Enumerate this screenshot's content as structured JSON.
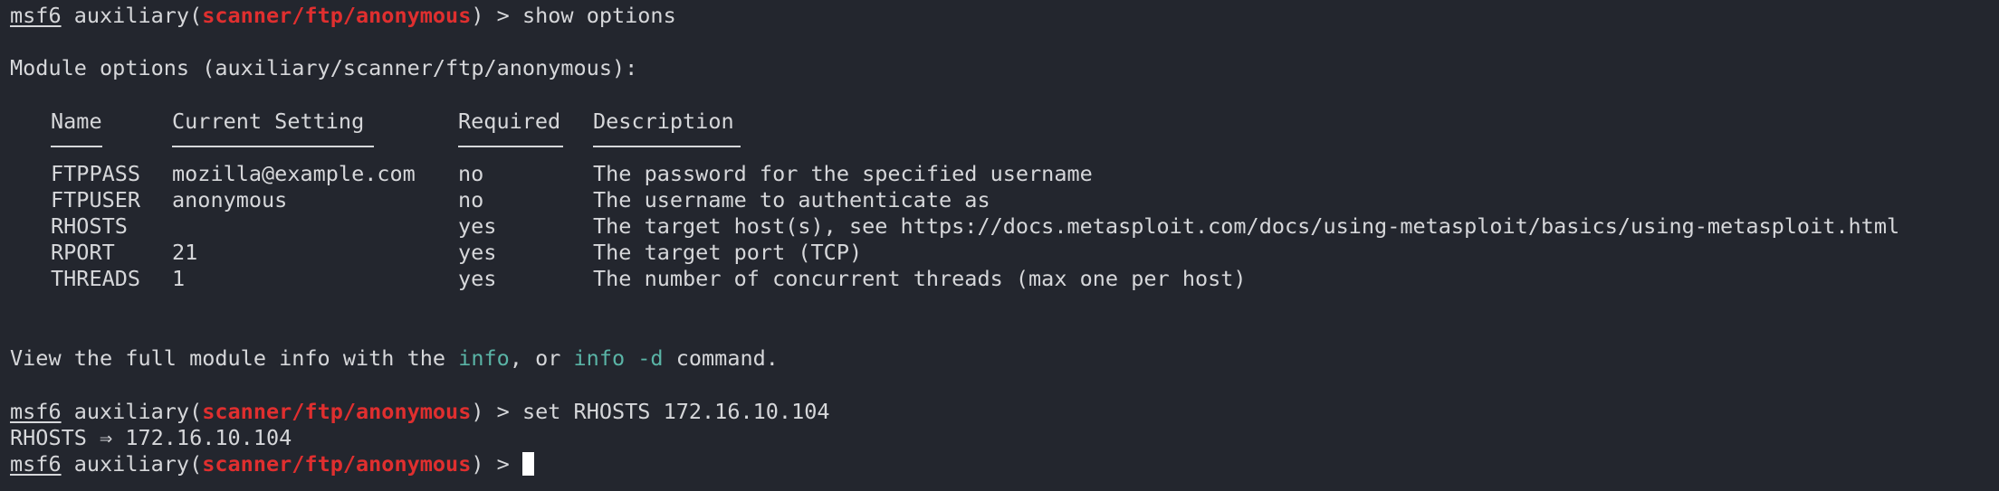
{
  "prompt": {
    "msf": "msf6",
    "pre": " auxiliary(",
    "module": "scanner/ftp/anonymous",
    "post": ") > "
  },
  "commands": {
    "show": "show options",
    "set": "set RHOSTS 172.16.10.104"
  },
  "module_options_header": "Module options (auxiliary/scanner/ftp/anonymous):",
  "table": {
    "headers": {
      "name": "Name",
      "setting": "Current Setting",
      "required": "Required",
      "description": "Description"
    },
    "rows": [
      {
        "name": "FTPPASS",
        "setting": "mozilla@example.com",
        "required": "no",
        "description": "The password for the specified username"
      },
      {
        "name": "FTPUSER",
        "setting": "anonymous",
        "required": "no",
        "description": "The username to authenticate as"
      },
      {
        "name": "RHOSTS",
        "setting": "",
        "required": "yes",
        "description": "The target host(s), see https://docs.metasploit.com/docs/using-metasploit/basics/using-metasploit.html"
      },
      {
        "name": "RPORT",
        "setting": "21",
        "required": "yes",
        "description": "The target port (TCP)"
      },
      {
        "name": "THREADS",
        "setting": "1",
        "required": "yes",
        "description": "The number of concurrent threads (max one per host)"
      }
    ]
  },
  "info_line": {
    "pre": "View the full module info with the ",
    "info": "info",
    "mid": ", or ",
    "info_d": "info -d",
    "post": " command."
  },
  "set_output": "RHOSTS ⇒ 172.16.10.104"
}
